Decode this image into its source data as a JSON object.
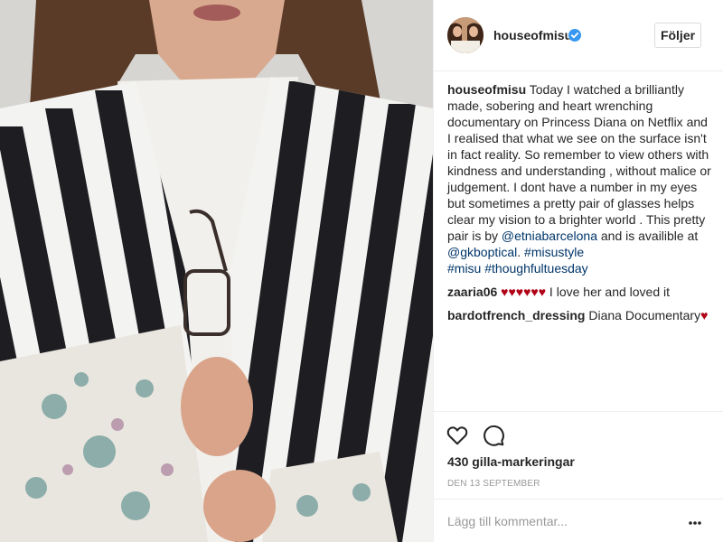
{
  "post": {
    "username": "houseofmisu",
    "follow_label": "Följer",
    "caption": {
      "author": "houseofmisu",
      "text_1": " Today I watched a brilliantly made, sobering and heart wrenching documentary on Princess Diana on Netflix and I realised that what we see on the surface isn't in fact reality. So remember to view others with kindness and understanding , without malice or judgement. I dont have a number in my eyes but sometimes a pretty pair of glasses helps clear my vision to a brighter world . This pretty pair is by ",
      "mention_1": "@etniabarcelona",
      "text_2": " and is availible at ",
      "mention_2": "@gkboptical",
      "text_3": ". ",
      "hashtag_1": "#misustyle",
      "hashtag_2": "#misu",
      "hashtag_3": "#thoughfultuesday"
    },
    "comments": [
      {
        "author": "zaaria06",
        "hearts": "♥♥♥♥♥♥",
        "text": " I love her and loved it"
      },
      {
        "author": "bardotfrench_dressing",
        "text": " Diana Documentary",
        "hearts": "♥"
      }
    ],
    "likes": "430 gilla-markeringar",
    "date": "DEN 13 SEPTEMBER",
    "add_comment_placeholder": "Lägg till kommentar..."
  },
  "icons": {
    "verified": "verified-badge-icon",
    "like": "heart-outline-icon",
    "comment": "speech-bubble-icon",
    "more": "more-options-icon"
  },
  "colors": {
    "link": "#003569",
    "heart": "#b00016",
    "verified": "#3897f0",
    "muted": "#999999",
    "border": "#efefef"
  }
}
